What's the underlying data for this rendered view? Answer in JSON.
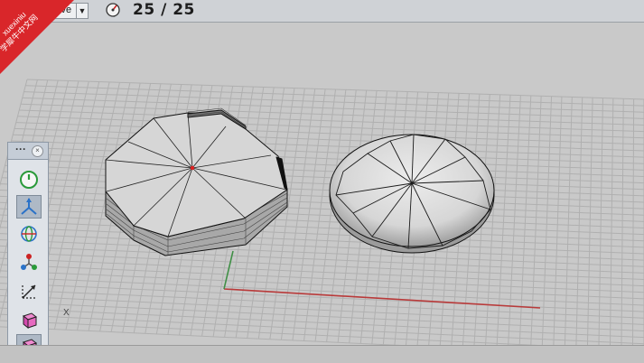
{
  "toolbar_top": {
    "display_mode": "Live",
    "frame_counter": "25 / 25"
  },
  "watermark": {
    "line1": "xuexiniu",
    "line2": "学犀牛中文网",
    "color": "#d9262a"
  },
  "axis_marker": "X",
  "floating_toolbar": {
    "header_label": "···",
    "close_glyph": "×",
    "tools": [
      {
        "name": "power-icon",
        "active": false
      },
      {
        "name": "axis-tripod-icon",
        "active": true
      },
      {
        "name": "globe-icon",
        "active": false
      },
      {
        "name": "molecule-icon",
        "active": false
      },
      {
        "name": "scale-axes-icon",
        "active": false
      },
      {
        "name": "cube-box-icon",
        "active": false
      },
      {
        "name": "cube-selected-icon",
        "active": true
      }
    ]
  },
  "colors": {
    "grid_bg": "#c9c9c9",
    "grid_line": "#b2b2b2",
    "x_axis": "#b93a3a",
    "y_axis": "#3f8f45",
    "object_fill": "#d6d6d6",
    "object_edge": "#111111"
  }
}
